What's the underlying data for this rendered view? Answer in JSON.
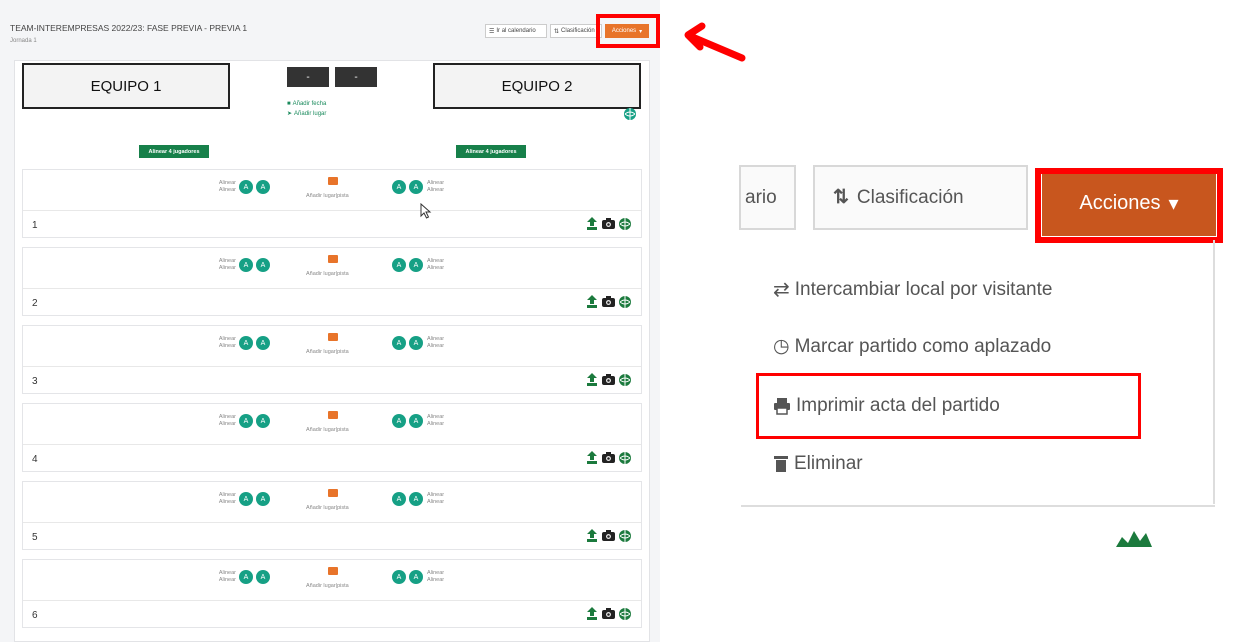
{
  "header": {
    "title": "TEAM-INTEREMPRESAS 2022/23: FASE PREVIA - PREVIA 1",
    "subtitle": "Jornada 1",
    "btn_calendar": "Ir al calendario",
    "btn_classification": "Clasificación",
    "btn_actions": "Acciones"
  },
  "match_header": {
    "team1": "EQUIPO 1",
    "team2": "EQUIPO 2",
    "score_home": "-",
    "score_away": "-",
    "add_date": "Añadir fecha",
    "add_place": "Añadir lugar",
    "align_btn_left": "Alinear 4 jugadores",
    "align_btn_right": "Alinear 4 jugadores"
  },
  "games": [
    {
      "number": "1",
      "align_top": "Alinear",
      "align_bottom": "Alinear",
      "avatar": "A",
      "court_label": "Añadir lugar|pista"
    },
    {
      "number": "2",
      "align_top": "Alinear",
      "align_bottom": "Alinear",
      "avatar": "A",
      "court_label": "Añadir lugar|pista"
    },
    {
      "number": "3",
      "align_top": "Alinear",
      "align_bottom": "Alinear",
      "avatar": "A",
      "court_label": "Añadir lugar|pista"
    },
    {
      "number": "4",
      "align_top": "Alinear",
      "align_bottom": "Alinear",
      "avatar": "A",
      "court_label": "Añadir lugar|pista"
    },
    {
      "number": "5",
      "align_top": "Alinear",
      "align_bottom": "Alinear",
      "avatar": "A",
      "court_label": "Añadir lugar|pista"
    },
    {
      "number": "6",
      "align_top": "Alinear",
      "align_bottom": "Alinear",
      "avatar": "A",
      "court_label": "Añadir lugar|pista"
    }
  ],
  "zoom": {
    "btn_calendar_partial": "ario",
    "btn_classification": "Clasificación",
    "btn_actions": "Acciones",
    "menu": [
      {
        "label": "Intercambiar local por visitante",
        "icon": "swap-icon"
      },
      {
        "label": "Marcar partido como aplazado",
        "icon": "clock-icon"
      },
      {
        "label": "Imprimir acta del partido",
        "icon": "print-icon"
      },
      {
        "label": "Eliminar",
        "icon": "trash-icon"
      }
    ]
  },
  "colors": {
    "accent_orange": "#e8742a",
    "green": "#17804a",
    "teal": "#16a085",
    "highlight_red": "#ff0000"
  }
}
